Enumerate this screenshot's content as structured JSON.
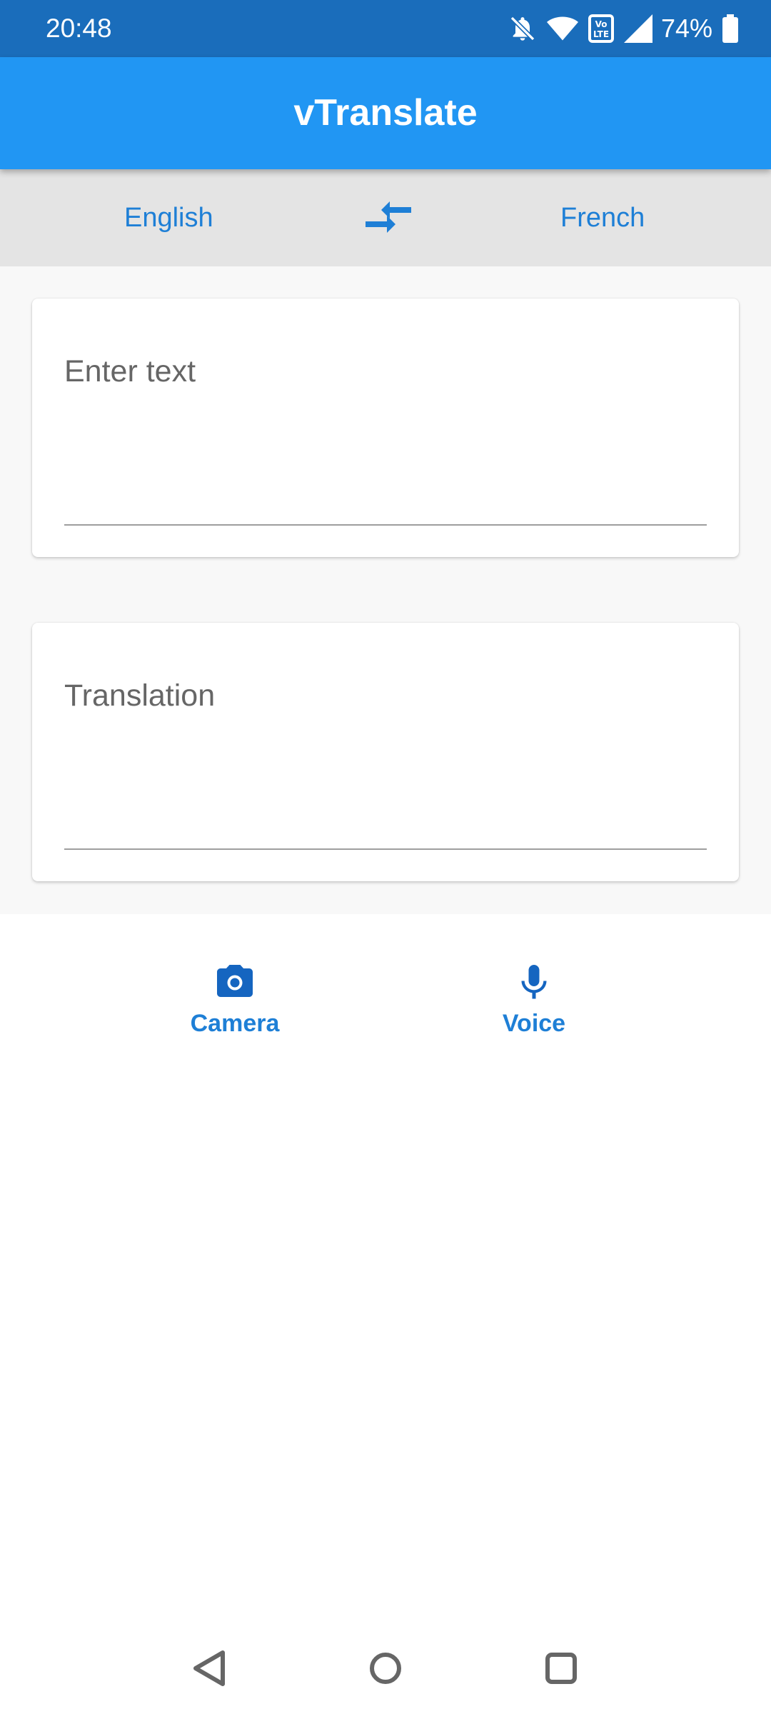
{
  "status_bar": {
    "time": "20:48",
    "battery_percent": "74%",
    "icons": [
      "bell-muted-icon",
      "wifi-icon",
      "volte-icon",
      "cell-signal-icon",
      "battery-icon"
    ]
  },
  "app_bar": {
    "title": "vTranslate"
  },
  "language_bar": {
    "source_language": "English",
    "target_language": "French",
    "swap_icon": "swap-arrows-icon"
  },
  "input_card": {
    "placeholder": "Enter text",
    "value": ""
  },
  "output_card": {
    "label": "Translation"
  },
  "actions": {
    "camera_label": "Camera",
    "camera_icon": "camera-icon",
    "voice_label": "Voice",
    "voice_icon": "microphone-icon"
  },
  "navigation": {
    "buttons": [
      "back-icon",
      "home-icon",
      "recents-icon"
    ]
  },
  "colors": {
    "status_bar": "#1a6dbb",
    "app_bar": "#2196f3",
    "accent": "#1e7fd6",
    "language_bar": "#e4e4e4",
    "content_background": "#f8f8f8"
  }
}
